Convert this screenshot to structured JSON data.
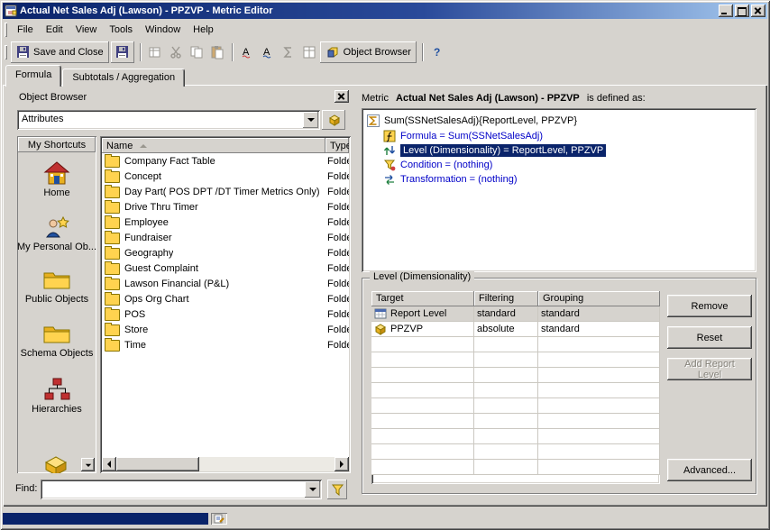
{
  "colors": {
    "titlebar_start": "#0a246a",
    "titlebar_end": "#a6caf0",
    "selection": "#0a246a",
    "link_blue": "#0000c8",
    "window_bg": "#d6d3ce",
    "folder_yellow": "#ffd34f"
  },
  "window": {
    "title": "Actual Net Sales Adj (Lawson) - PPZVP - Metric Editor",
    "menu": [
      "File",
      "Edit",
      "View",
      "Tools",
      "Window",
      "Help"
    ],
    "tabs": [
      {
        "label": "Formula"
      },
      {
        "label": "Subtotals / Aggregation"
      }
    ]
  },
  "toolbar": {
    "save_and_close": "Save and Close",
    "object_browser": "Object Browser"
  },
  "object_browser": {
    "title": "Object Browser",
    "dropdown_value": "Attributes",
    "shortcuts_title": "My Shortcuts",
    "shortcuts": [
      "Home",
      "My Personal Ob...",
      "Public Objects",
      "Schema Objects",
      "Hierarchies"
    ],
    "columns": [
      "Name",
      "Type"
    ],
    "type_text": "Folde",
    "folders": [
      "Company Fact Table",
      "Concept",
      "Day Part( POS DPT /DT Timer  Metrics Only)",
      "Drive Thru Timer",
      "Employee",
      "Fundraiser",
      "Geography",
      "Guest Complaint",
      "Lawson Financial (P&L)",
      "Ops Org Chart",
      "POS",
      "Store",
      "Time"
    ],
    "find_label": "Find:",
    "find_value": ""
  },
  "metric": {
    "label": "Metric",
    "name": "Actual Net Sales Adj (Lawson) - PPZVP",
    "suffix": "is defined as:",
    "definition": [
      {
        "text": "Sum(SSNetSalesAdj){ReportLevel, PPZVP}"
      },
      {
        "text": "Formula = Sum(SSNetSalesAdj)"
      },
      {
        "text": "Level (Dimensionality) = ReportLevel, PPZVP"
      },
      {
        "text": "Condition = (nothing)"
      },
      {
        "text": "Transformation = (nothing)"
      }
    ]
  },
  "level_panel": {
    "title": "Level (Dimensionality)",
    "columns": [
      "Target",
      "Filtering",
      "Grouping"
    ],
    "rows": [
      {
        "target": "Report Level",
        "filtering": "standard",
        "grouping": "standard"
      },
      {
        "target": "PPZVP",
        "filtering": "absolute",
        "grouping": "standard"
      }
    ],
    "buttons": {
      "remove": "Remove",
      "reset": "Reset",
      "add_report_level": "Add Report Level",
      "advanced": "Advanced..."
    }
  }
}
